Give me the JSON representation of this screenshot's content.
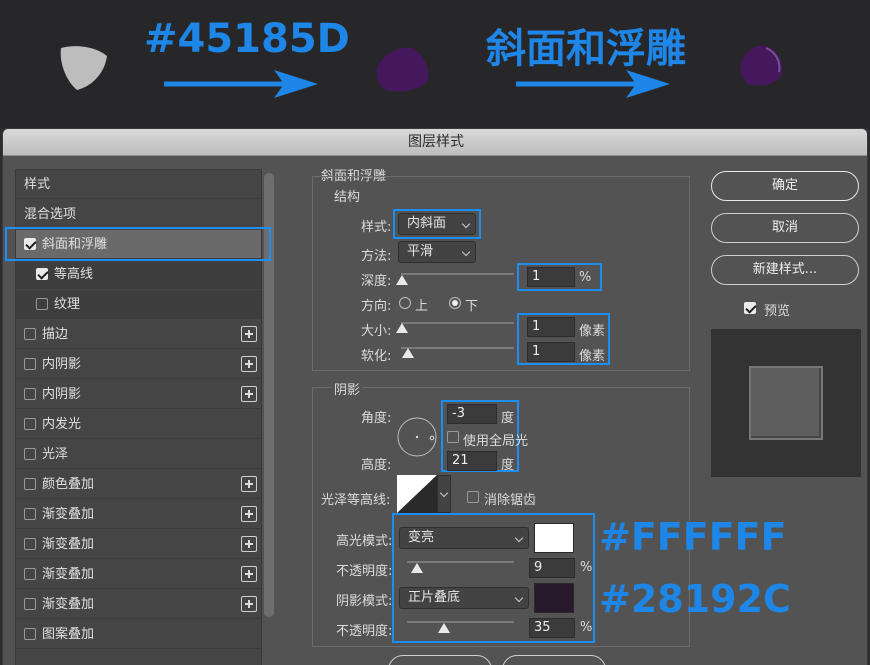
{
  "banner": {
    "hex_label": "#45185D",
    "effect_label": "斜面和浮雕",
    "colors": {
      "shape_gray": "#bdbdbd",
      "shape_purple": "#45185D",
      "arrow": "#1d86e6"
    }
  },
  "dialog": {
    "title": "图层样式",
    "style_list": [
      {
        "label": "样式",
        "checkbox": false,
        "checked": false,
        "plus": false,
        "state": "header"
      },
      {
        "label": "混合选项",
        "checkbox": false,
        "checked": false,
        "plus": false,
        "state": "normal"
      },
      {
        "label": "斜面和浮雕",
        "checkbox": true,
        "checked": true,
        "plus": false,
        "state": "selected"
      },
      {
        "label": "等高线",
        "checkbox": true,
        "checked": true,
        "plus": false,
        "state": "sub"
      },
      {
        "label": "纹理",
        "checkbox": true,
        "checked": false,
        "plus": false,
        "state": "sub"
      },
      {
        "label": "描边",
        "checkbox": true,
        "checked": false,
        "plus": true,
        "state": "normal"
      },
      {
        "label": "内阴影",
        "checkbox": true,
        "checked": false,
        "plus": true,
        "state": "normal"
      },
      {
        "label": "内阴影",
        "checkbox": true,
        "checked": false,
        "plus": true,
        "state": "normal"
      },
      {
        "label": "内发光",
        "checkbox": true,
        "checked": false,
        "plus": false,
        "state": "normal"
      },
      {
        "label": "光泽",
        "checkbox": true,
        "checked": false,
        "plus": false,
        "state": "normal"
      },
      {
        "label": "颜色叠加",
        "checkbox": true,
        "checked": false,
        "plus": true,
        "state": "normal"
      },
      {
        "label": "渐变叠加",
        "checkbox": true,
        "checked": false,
        "plus": true,
        "state": "normal"
      },
      {
        "label": "渐变叠加",
        "checkbox": true,
        "checked": false,
        "plus": true,
        "state": "normal"
      },
      {
        "label": "渐变叠加",
        "checkbox": true,
        "checked": false,
        "plus": true,
        "state": "normal"
      },
      {
        "label": "渐变叠加",
        "checkbox": true,
        "checked": false,
        "plus": true,
        "state": "normal"
      },
      {
        "label": "图案叠加",
        "checkbox": true,
        "checked": false,
        "plus": false,
        "state": "normal"
      }
    ],
    "bevel": {
      "section_title": "斜面和浮雕",
      "structure_title": "结构",
      "style_label": "样式:",
      "style_value": "内斜面",
      "technique_label": "方法:",
      "technique_value": "平滑",
      "depth_label": "深度:",
      "depth_value": "1",
      "depth_unit": "%",
      "depth_level": 0.01,
      "direction_label": "方向:",
      "direction_up": "上",
      "direction_down": "下",
      "direction_selected": "下",
      "size_label": "大小:",
      "size_value": "1",
      "size_unit": "像素",
      "size_level": 0.01,
      "soften_label": "软化:",
      "soften_value": "1",
      "soften_unit": "像素",
      "soften_level": 0.06
    },
    "shading": {
      "title": "阴影",
      "angle_label": "角度:",
      "angle_value": "-3",
      "angle_unit": "度",
      "global_light_label": "使用全局光",
      "global_light_checked": false,
      "altitude_label": "高度:",
      "altitude_value": "21",
      "altitude_unit": "度",
      "gloss_contour_label": "光泽等高线:",
      "anti_alias_label": "消除锯齿",
      "anti_alias_checked": false,
      "highlight_mode_label": "高光模式:",
      "highlight_mode_value": "变亮",
      "highlight_color": "#FFFFFF",
      "highlight_opacity_label": "不透明度:",
      "highlight_opacity_value": "9",
      "highlight_opacity_unit": "%",
      "highlight_opacity_level": 0.09,
      "shadow_mode_label": "阴影模式:",
      "shadow_mode_value": "正片叠底",
      "shadow_color": "#28192C",
      "shadow_opacity_label": "不透明度:",
      "shadow_opacity_value": "35",
      "shadow_opacity_unit": "%",
      "shadow_opacity_level": 0.35
    },
    "annotations": {
      "highlight_hex": "#FFFFFF",
      "shadow_hex": "#28192C"
    },
    "buttons": {
      "ok": "确定",
      "cancel": "取消",
      "new_style": "新建样式...",
      "preview_label": "预览",
      "preview_checked": true
    },
    "colors": {
      "accent_blue": "#1c8ef0",
      "panel": "#535353",
      "list_bg": "#454545",
      "selected_row": "#6a6a6a"
    }
  }
}
